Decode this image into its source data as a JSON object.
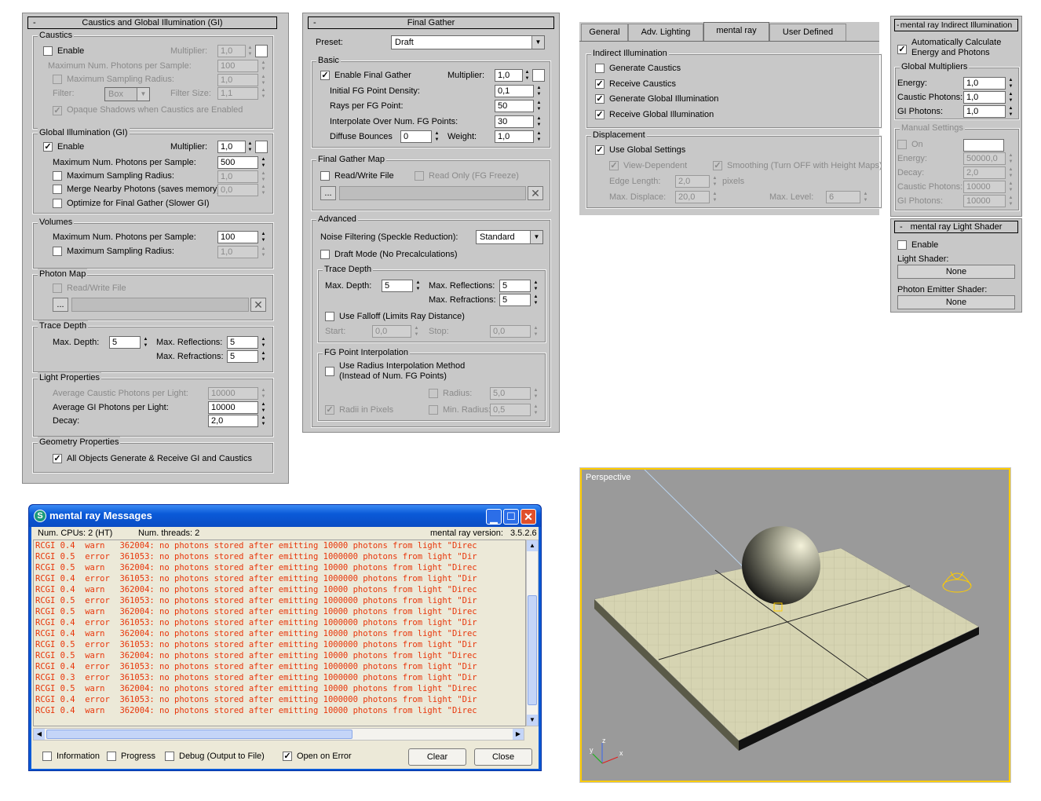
{
  "caustics_panel": {
    "title": "Caustics and Global Illumination (GI)",
    "minus": "-",
    "caustics_group": "Caustics",
    "enable": "Enable",
    "multiplier": "Multiplier:",
    "multiplier_val": "1,0",
    "max_photons": "Maximum Num. Photons per Sample:",
    "max_photons_val": "100",
    "max_radius": "Maximum Sampling Radius:",
    "max_radius_val": "1,0",
    "filter": "Filter:",
    "filter_val": "Box",
    "filter_size": "Filter Size:",
    "filter_size_val": "1,1",
    "opaque": "Opaque Shadows when Caustics are Enabled",
    "gi_group": "Global Illumination (GI)",
    "gi_enable": "Enable",
    "gi_multiplier": "Multiplier:",
    "gi_multiplier_val": "1,0",
    "gi_max_photons": "Maximum Num. Photons per Sample:",
    "gi_max_photons_val": "500",
    "gi_max_radius": "Maximum Sampling Radius:",
    "gi_max_radius_val": "1,0",
    "gi_merge": "Merge Nearby Photons (saves memory):",
    "gi_merge_val": "0,0",
    "gi_optimize": "Optimize for Final Gather (Slower GI)",
    "vol_group": "Volumes",
    "vol_max_photons": "Maximum Num. Photons per Sample:",
    "vol_max_photons_val": "100",
    "vol_max_radius": "Maximum Sampling Radius:",
    "vol_max_radius_val": "1,0",
    "pm_group": "Photon Map",
    "pm_rw": "Read/Write File",
    "pm_browse": "...",
    "td_group": "Trace Depth",
    "td_max_depth": "Max. Depth:",
    "td_max_depth_val": "5",
    "td_max_refl": "Max. Reflections:",
    "td_max_refl_val": "5",
    "td_max_refr": "Max. Refractions:",
    "td_max_refr_val": "5",
    "lp_group": "Light Properties",
    "lp_avg_caustic": "Average Caustic Photons per Light:",
    "lp_avg_caustic_val": "10000",
    "lp_avg_gi": "Average GI Photons per Light:",
    "lp_avg_gi_val": "10000",
    "lp_decay": "Decay:",
    "lp_decay_val": "2,0",
    "gp_group": "Geometry Properties",
    "gp_all": "All Objects Generate & Receive GI and Caustics"
  },
  "fg_panel": {
    "title": "Final Gather",
    "minus": "-",
    "preset": "Preset:",
    "preset_val": "Draft",
    "basic_group": "Basic",
    "enable_fg": "Enable Final Gather",
    "multiplier": "Multiplier:",
    "multiplier_val": "1,0",
    "density": "Initial FG Point Density:",
    "density_val": "0,1",
    "rays": "Rays per FG Point:",
    "rays_val": "50",
    "interp": "Interpolate Over Num. FG Points:",
    "interp_val": "30",
    "bounces": "Diffuse Bounces",
    "bounces_val": "0",
    "weight": "Weight:",
    "weight_val": "1,0",
    "fgmap_group": "Final Gather Map",
    "rw": "Read/Write File",
    "readonly": "Read Only (FG Freeze)",
    "browse": "...",
    "adv_group": "Advanced",
    "noise": "Noise Filtering (Speckle Reduction):",
    "noise_val": "Standard",
    "draft_mode": "Draft Mode (No Precalculations)",
    "td_group": "Trace Depth",
    "max_depth": "Max. Depth:",
    "max_depth_val": "5",
    "max_refl": "Max. Reflections:",
    "max_refl_val": "5",
    "max_refr": "Max. Refractions:",
    "max_refr_val": "5",
    "falloff": "Use Falloff (Limits Ray Distance)",
    "start": "Start:",
    "start_val": "0,0",
    "stop": "Stop:",
    "stop_val": "0,0",
    "fgi_group": "FG Point Interpolation",
    "radius_method1": "Use Radius Interpolation Method",
    "radius_method2": "(Instead of Num. FG Points)",
    "radius": "Radius:",
    "radius_val": "5,0",
    "radii_pixels": "Radii in Pixels",
    "min_radius": "Min. Radius:",
    "min_radius_val": "0,5"
  },
  "tabs_panel": {
    "tabs": [
      "General",
      "Adv. Lighting",
      "mental ray",
      "User Defined"
    ],
    "ii_group": "Indirect Illumination",
    "gen_caustics": "Generate Caustics",
    "recv_caustics": "Receive Caustics",
    "gen_gi": "Generate Global Illumination",
    "recv_gi": "Receive Global Illumination",
    "disp_group": "Displacement",
    "use_global": "Use Global Settings",
    "view_dep": "View-Dependent",
    "smoothing": "Smoothing (Turn OFF with Height Maps)",
    "edge_len": "Edge Length:",
    "edge_len_val": "2,0",
    "pixels": "pixels",
    "max_disp": "Max. Displace:",
    "max_disp_val": "20,0",
    "max_level": "Max. Level:",
    "max_level_val": "6"
  },
  "mr_ii_panel": {
    "title": "mental ray Indirect Illumination",
    "minus": "-",
    "auto1": "Automatically Calculate",
    "auto2": "Energy and Photons",
    "gm_group": "Global Multipliers",
    "energy": "Energy:",
    "energy_val": "1,0",
    "caustic_ph": "Caustic Photons:",
    "caustic_ph_val": "1,0",
    "gi_ph": "GI Photons:",
    "gi_ph_val": "1,0",
    "ms_group": "Manual Settings",
    "on": "On",
    "m_energy": "Energy:",
    "m_energy_val": "50000,0",
    "m_decay": "Decay:",
    "m_decay_val": "2,0",
    "m_caustic": "Caustic Photons:",
    "m_caustic_val": "10000",
    "m_gi": "GI Photons:",
    "m_gi_val": "10000"
  },
  "mr_ls_panel": {
    "title": "mental ray Light Shader",
    "minus": "-",
    "enable": "Enable",
    "light_shader": "Light Shader:",
    "none1": "None",
    "photon_emitter": "Photon Emitter Shader:",
    "none2": "None"
  },
  "messages": {
    "title": "mental ray Messages",
    "cpus": "Num. CPUs: 2 (HT)",
    "threads": "Num. threads: 2",
    "version_label": "mental ray version:",
    "version": "3.5.2.6",
    "lines": [
      "RCGI 0.4  warn   362004: no photons stored after emitting 10000 photons from light \"Direc",
      "RCGI 0.5  error  361053: no photons stored after emitting 1000000 photons from light \"Dir",
      "RCGI 0.5  warn   362004: no photons stored after emitting 10000 photons from light \"Direc",
      "RCGI 0.4  error  361053: no photons stored after emitting 1000000 photons from light \"Dir",
      "RCGI 0.4  warn   362004: no photons stored after emitting 10000 photons from light \"Direc",
      "RCGI 0.5  error  361053: no photons stored after emitting 1000000 photons from light \"Dir",
      "RCGI 0.5  warn   362004: no photons stored after emitting 10000 photons from light \"Direc",
      "RCGI 0.4  error  361053: no photons stored after emitting 1000000 photons from light \"Dir",
      "RCGI 0.4  warn   362004: no photons stored after emitting 10000 photons from light \"Direc",
      "RCGI 0.5  error  361053: no photons stored after emitting 1000000 photons from light \"Dir",
      "RCGI 0.5  warn   362004: no photons stored after emitting 10000 photons from light \"Direc",
      "RCGI 0.4  error  361053: no photons stored after emitting 1000000 photons from light \"Dir",
      "RCGI 0.3  error  361053: no photons stored after emitting 1000000 photons from light \"Dir",
      "RCGI 0.5  warn   362004: no photons stored after emitting 10000 photons from light \"Direc",
      "RCGI 0.4  error  361053: no photons stored after emitting 1000000 photons from light \"Dir",
      "RCGI 0.4  warn   362004: no photons stored after emitting 10000 photons from light \"Direc"
    ],
    "info": "Information",
    "progress": "Progress",
    "debug": "Debug (Output to File)",
    "open_on_error": "Open on Error",
    "clear": "Clear",
    "close": "Close"
  },
  "viewport": {
    "label": "Perspective",
    "axis_z": "z",
    "axis_x": "x",
    "axis_y": "y"
  },
  "colors": {
    "panel_bg": "#c8c8c8",
    "msg_text": "#e8360a",
    "viewport_border": "#ffcc00",
    "xp_blue": "#0a5ad8"
  }
}
